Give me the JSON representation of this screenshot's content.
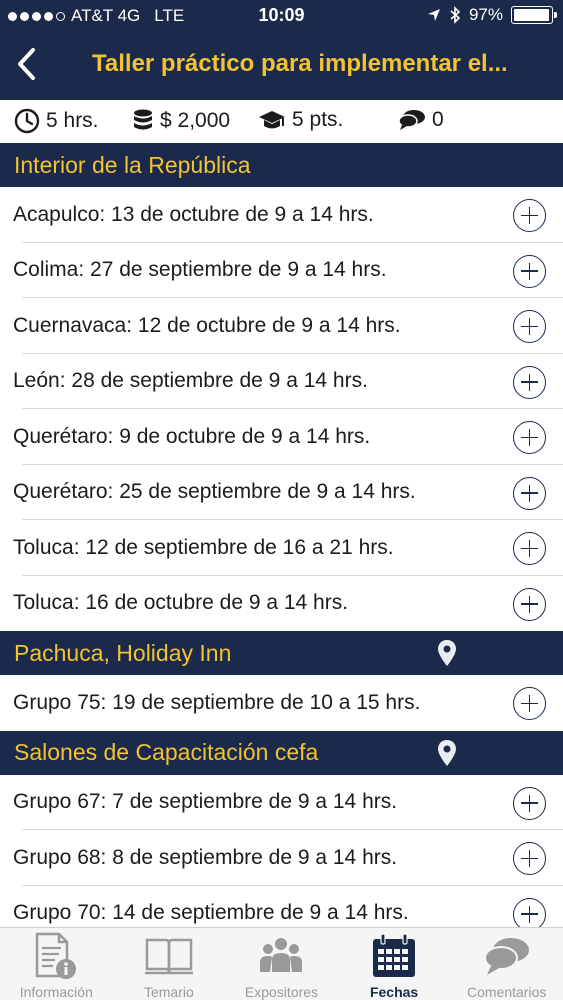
{
  "status_bar": {
    "carrier": "AT&T 4G",
    "network": "LTE",
    "time": "10:09",
    "battery": "97%",
    "battery_level": 0.97
  },
  "nav": {
    "title": "Taller práctico para implementar el..."
  },
  "info": {
    "duration": "5 hrs.",
    "price": "$ 2,000",
    "points": "5 pts.",
    "comments": "0"
  },
  "sections": [
    {
      "title": "Interior de la República",
      "rows": [
        "Acapulco: 13 de octubre de 9 a 14 hrs.",
        "Colima: 27 de septiembre de 9 a 14 hrs.",
        "Cuernavaca: 12 de octubre de 9 a 14 hrs.",
        "León: 28 de septiembre de 9 a 14 hrs.",
        "Querétaro: 9 de octubre de 9 a 14 hrs.",
        "Querétaro: 25 de septiembre de 9 a 14 hrs.",
        "Toluca: 12 de septiembre de 16 a 21 hrs.",
        "Toluca: 16 de octubre de 9 a 14 hrs."
      ]
    },
    {
      "title": "Pachuca, Holiday Inn",
      "rows": [
        "Grupo 75: 19 de septiembre de 10 a 15 hrs."
      ]
    },
    {
      "title": "Salones de Capacitación cefa",
      "rows": [
        "Grupo 67: 7 de septiembre de 9 a 14 hrs.",
        "Grupo 68: 8 de septiembre de 9 a 14 hrs.",
        "Grupo 70: 14 de septiembre de 9 a 14 hrs."
      ]
    }
  ],
  "tabs": [
    {
      "label": "Información",
      "icon": "document-info-icon"
    },
    {
      "label": "Temario",
      "icon": "open-book-icon"
    },
    {
      "label": "Expositores",
      "icon": "group-people-icon"
    },
    {
      "label": "Fechas",
      "icon": "calendar-icon"
    },
    {
      "label": "Comentarios",
      "icon": "chat-bubbles-icon"
    }
  ],
  "active_tab": "Fechas",
  "colors": {
    "navy": "#1b2a4a",
    "gold": "#f1c232",
    "inactive_tab": "#9a9a9a"
  }
}
